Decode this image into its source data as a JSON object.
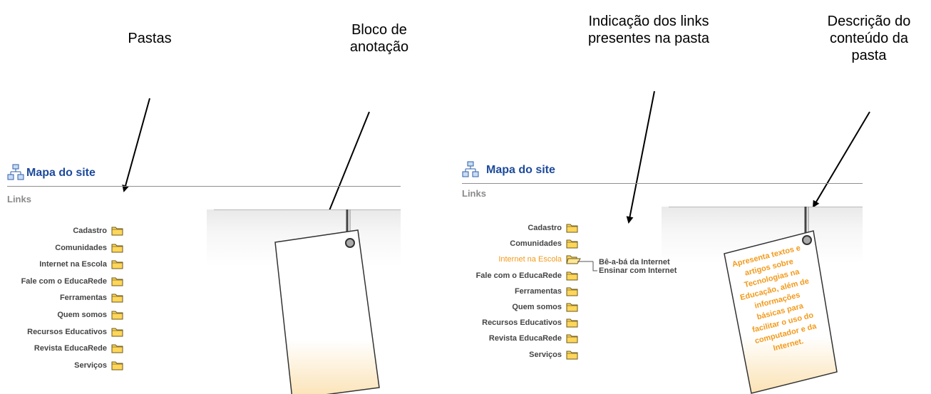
{
  "callouts": {
    "pastas": "Pastas",
    "bloco": "Bloco de\nanotação",
    "indicacao": "Indicação dos links\npresentes na pasta",
    "descricao": "Descrição do\nconteúdo da\npasta"
  },
  "panel_left": {
    "title": "Mapa do site",
    "links_label": "Links",
    "folders": [
      {
        "label": "Cadastro"
      },
      {
        "label": "Comunidades"
      },
      {
        "label": "Internet na Escola"
      },
      {
        "label": "Fale com o EducaRede"
      },
      {
        "label": "Ferramentas"
      },
      {
        "label": "Quem somos"
      },
      {
        "label": "Recursos Educativos"
      },
      {
        "label": "Revista EducaRede"
      },
      {
        "label": "Serviços"
      }
    ]
  },
  "panel_right": {
    "title": "Mapa do site",
    "links_label": "Links",
    "folders": [
      {
        "label": "Cadastro"
      },
      {
        "label": "Comunidades"
      },
      {
        "label": "Internet na Escola",
        "active": true
      },
      {
        "label": "Fale com o EducaRede"
      },
      {
        "label": "Ferramentas"
      },
      {
        "label": "Quem somos"
      },
      {
        "label": "Recursos Educativos"
      },
      {
        "label": "Revista EducaRede"
      },
      {
        "label": "Serviços"
      }
    ],
    "sublinks": [
      "Bê-a-bá da Internet",
      "Ensinar com Internet"
    ],
    "tag_text": "Apresenta textos e\nartigos sobre\nTecnologias na\nEducação, além de\ninformações\nbásicas para\nfacilitar o uso do\ncomputador e da\nInternet."
  },
  "colors": {
    "title": "#1c4a9c",
    "active": "#f39a1a",
    "folder_fill": "#ffd65a",
    "folder_stroke": "#6b5a1e"
  },
  "icons": [
    "sitemap-icon",
    "folder-icon",
    "open-folder-icon"
  ]
}
